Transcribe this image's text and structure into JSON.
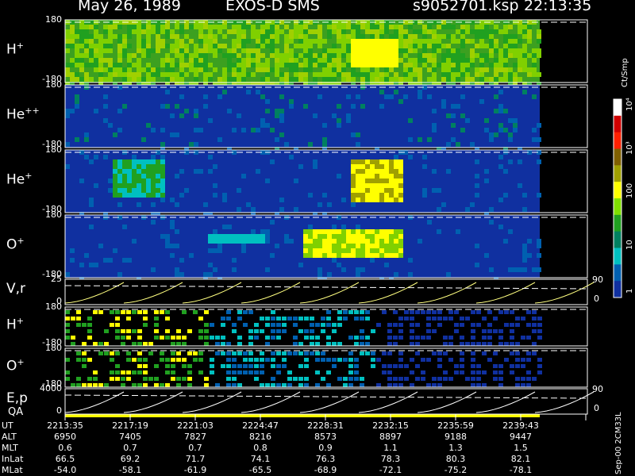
{
  "header": {
    "date": "May 26, 1989",
    "mission": "EXOS-D SMS",
    "file": "s9052701.ksp",
    "time": "22:13:35"
  },
  "colorbar": {
    "unit": "Ct/Smp",
    "tick_labels": [
      "10⁴",
      "10³",
      "100",
      "10",
      "1"
    ],
    "colors": [
      "#ffffff",
      "#d00000",
      "#ff2000",
      "#806000",
      "#a0a000",
      "#ffff00",
      "#80e000",
      "#20a020",
      "#008060",
      "#00c0c0",
      "#0060b0",
      "#1030a0"
    ]
  },
  "side_label": "Sep-00 2CM33L",
  "chart_data": {
    "type": "heatmap",
    "panels": [
      {
        "label": "H",
        "sup": "+",
        "ytop": "180",
        "ybottom": "-180"
      },
      {
        "label": "He",
        "sup": "++",
        "ytop": "180",
        "ybottom": "-180"
      },
      {
        "label": "He",
        "sup": "+",
        "ytop": "180",
        "ybottom": "-180"
      },
      {
        "label": "O",
        "sup": "+",
        "ytop": "180",
        "ybottom": "-180"
      },
      {
        "label": "V,r",
        "sup": "",
        "ytop": "25",
        "ybottom": "0",
        "rtop": "90",
        "rbottom": "0"
      },
      {
        "label": "H",
        "sup": "+",
        "ytop": "180",
        "ybottom": "-180"
      },
      {
        "label": "O",
        "sup": "+",
        "ytop": "180",
        "ybottom": "-180"
      },
      {
        "label": "E,p",
        "sup": "",
        "ytop": "4000",
        "ybottom": "0",
        "rtop": "90",
        "rbottom": "0"
      }
    ],
    "qa_label": "QA",
    "ephemeris": {
      "rows": [
        "UT",
        "ALT",
        "MLT",
        "InLat",
        "MLat"
      ],
      "columns": [
        {
          "UT": "2213:35",
          "ALT": "6950",
          "MLT": "0.6",
          "InLat": "66.5",
          "MLat": "-54.0"
        },
        {
          "UT": "2217:19",
          "ALT": "7405",
          "MLT": "0.7",
          "InLat": "69.2",
          "MLat": "-58.1"
        },
        {
          "UT": "2221:03",
          "ALT": "7827",
          "MLT": "0.7",
          "InLat": "71.7",
          "MLat": "-61.9"
        },
        {
          "UT": "2224:47",
          "ALT": "8216",
          "MLT": "0.8",
          "InLat": "74.1",
          "MLat": "-65.5"
        },
        {
          "UT": "2228:31",
          "ALT": "8573",
          "MLT": "0.9",
          "InLat": "76.3",
          "MLat": "-68.9"
        },
        {
          "UT": "2232:15",
          "ALT": "8897",
          "MLT": "1.1",
          "InLat": "78.3",
          "MLat": "-72.1"
        },
        {
          "UT": "2235:59",
          "ALT": "9188",
          "MLT": "1.3",
          "InLat": "80.3",
          "MLat": "-75.2"
        },
        {
          "UT": "2239:43",
          "ALT": "9447",
          "MLT": "1.5",
          "InLat": "82.1",
          "MLat": "-78.1"
        }
      ]
    }
  }
}
